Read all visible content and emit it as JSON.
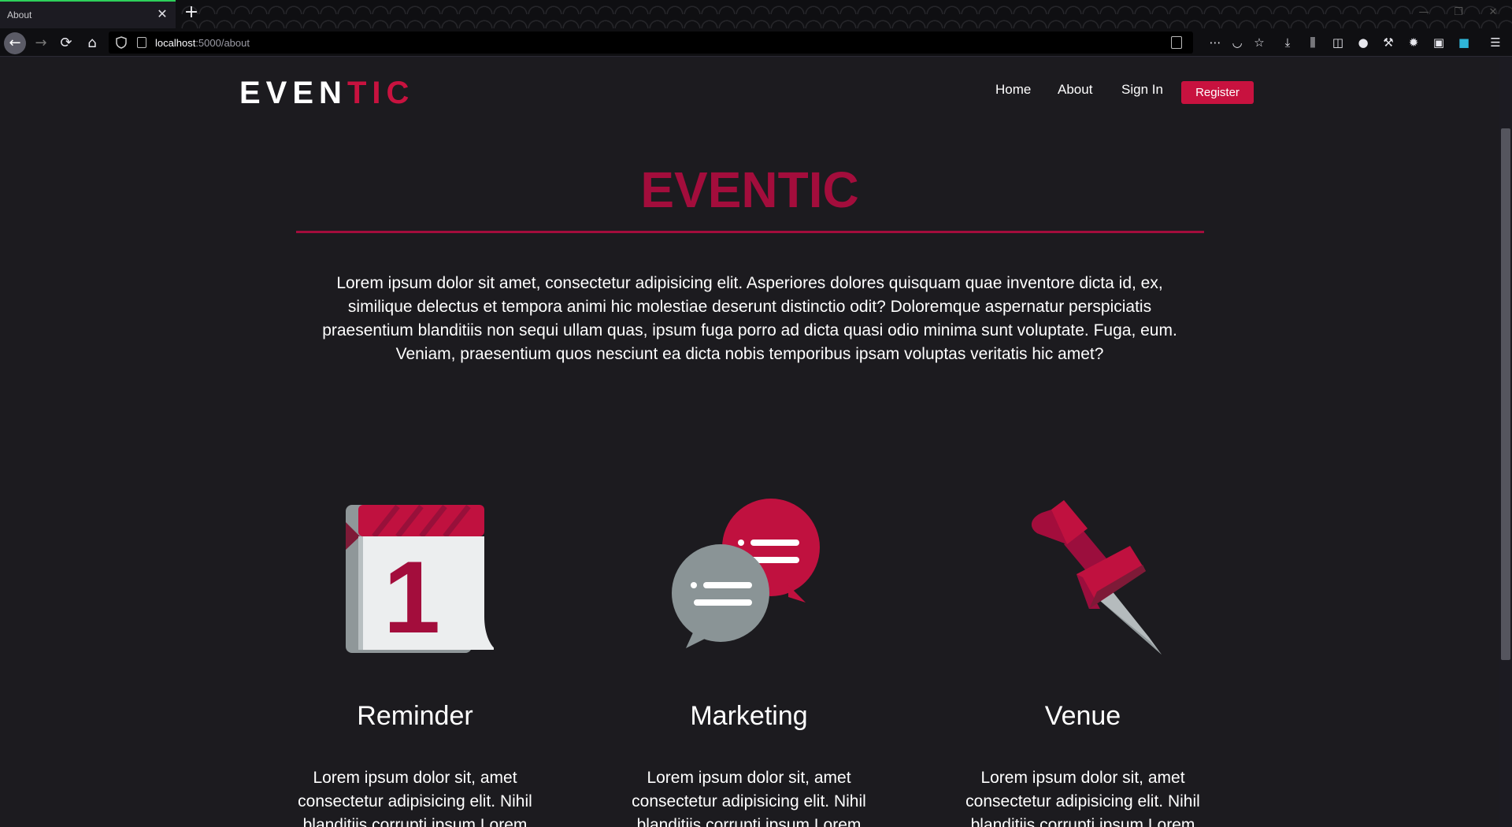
{
  "browser": {
    "tab_title": "About",
    "tab_close": "✕",
    "new_tab": "+",
    "url_host": "localhost",
    "url_path": ":5000/about"
  },
  "site": {
    "logo_part1": "EVEN",
    "logo_part2": "TIC",
    "nav": {
      "home": "Home",
      "about": "About",
      "sign_in": "Sign In",
      "register": "Register"
    },
    "accent_color": "#c8123f"
  },
  "hero": {
    "title": "EVENTIC",
    "text": "Lorem ipsum dolor sit amet, consectetur adipisicing elit. Asperiores dolores quisquam quae inventore dicta id, ex, similique delectus et tempora animi hic molestiae deserunt distinctio odit? Doloremque aspernatur perspiciatis praesentium blanditiis non sequi ullam quas, ipsum fuga porro ad dicta quasi odio minima sunt voluptate. Fuga, eum. Veniam, praesentium quos nesciunt ea dicta nobis temporibus ipsam voluptas veritatis hic amet?"
  },
  "features": [
    {
      "icon": "calendar-icon",
      "calendar_day": "1",
      "title": "Reminder",
      "text": "Lorem ipsum dolor sit, amet consectetur adipisicing elit. Nihil blanditiis corrupti ipsum Lorem"
    },
    {
      "icon": "chat-bubbles-icon",
      "title": "Marketing",
      "text": "Lorem ipsum dolor sit, amet consectetur adipisicing elit. Nihil blanditiis corrupti ipsum Lorem"
    },
    {
      "icon": "push-pin-icon",
      "title": "Venue",
      "text": "Lorem ipsum dolor sit, amet consectetur adipisicing elit. Nihil blanditiis corrupti ipsum Lorem"
    }
  ]
}
